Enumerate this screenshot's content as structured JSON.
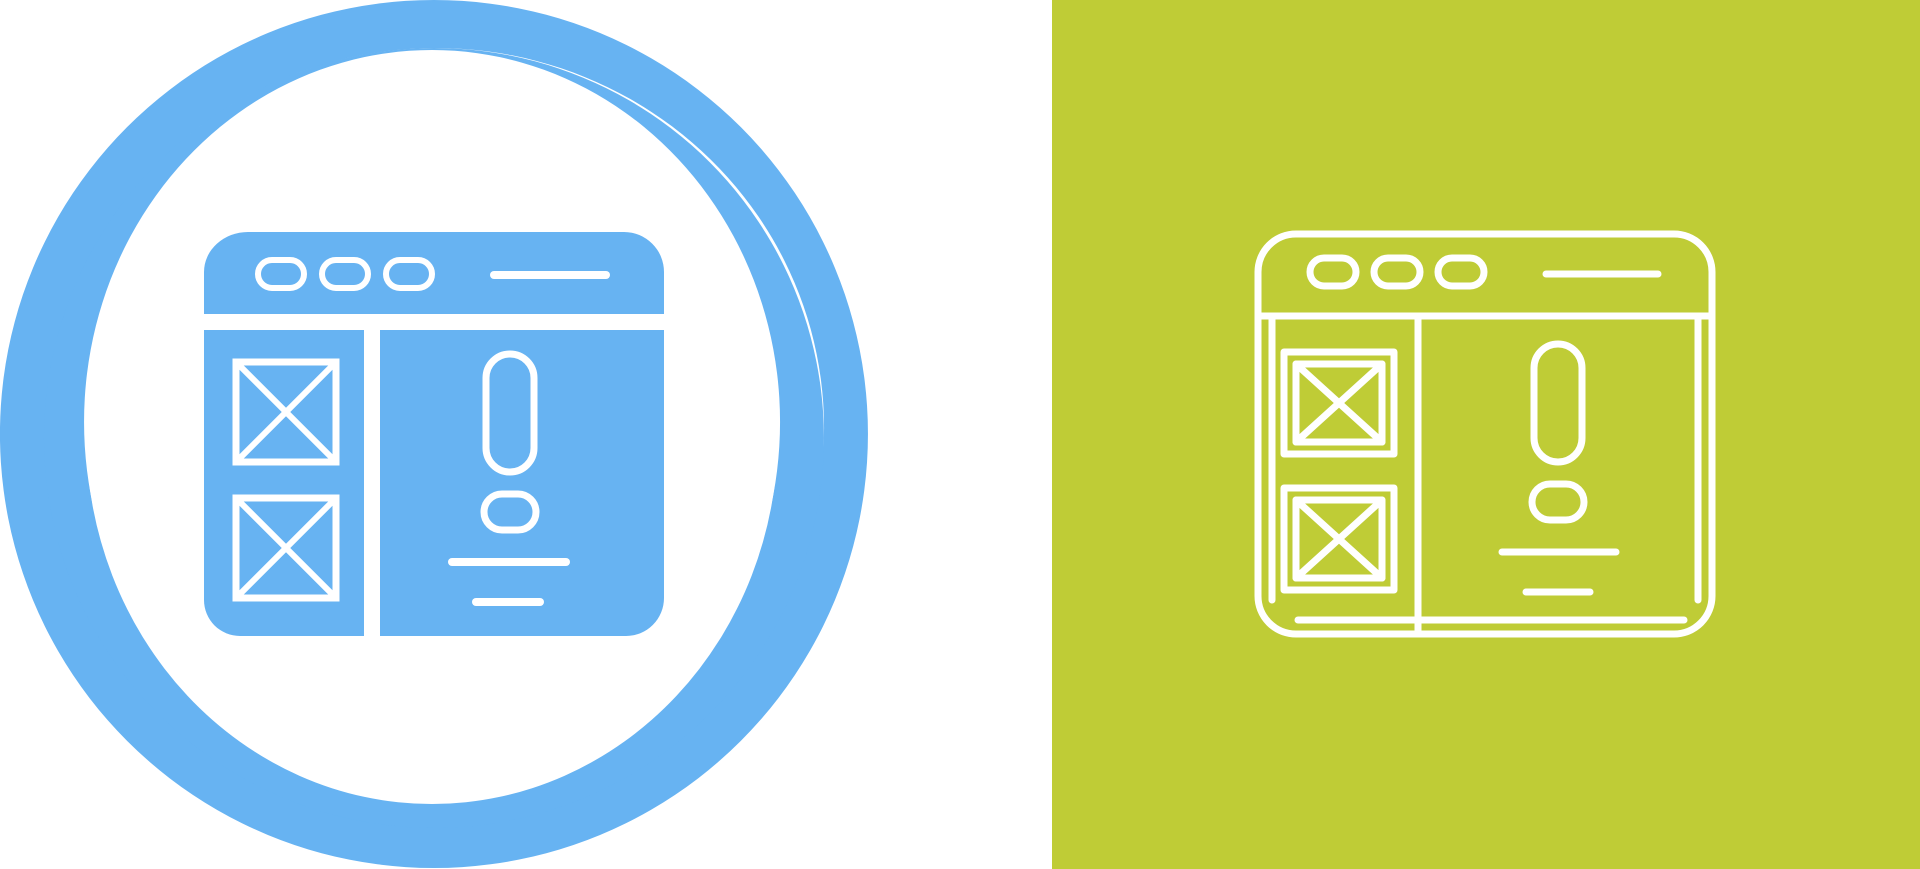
{
  "canvas": {
    "background": "#ffffff"
  },
  "left_icon": {
    "name": "browser-wireframe-error-glyph-icon",
    "style": "glyph",
    "fill_color": "#67b3f2",
    "detail_color": "#ffffff",
    "ring_color": "#67b3f2"
  },
  "right_icon": {
    "name": "browser-wireframe-error-line-icon",
    "style": "line",
    "panel_color": "#bfcc36",
    "stroke_color": "#ffffff"
  }
}
